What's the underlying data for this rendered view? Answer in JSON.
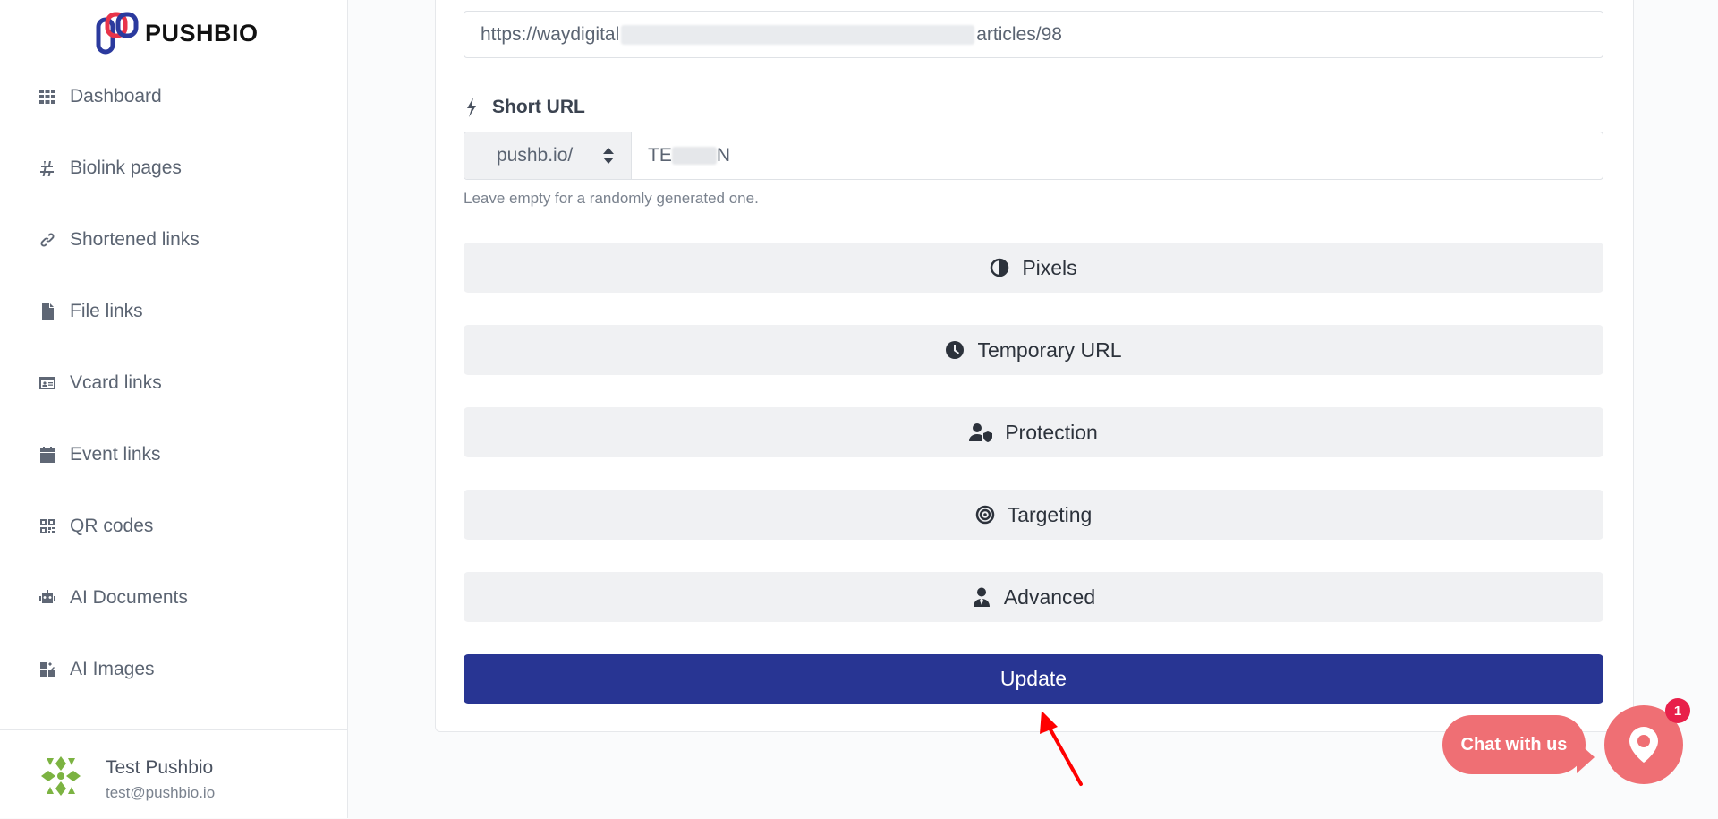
{
  "app": {
    "brand": "PUSHBIO"
  },
  "sidebar": {
    "items": [
      {
        "label": "Dashboard",
        "icon": "grid-icon"
      },
      {
        "label": "Biolink pages",
        "icon": "hash-icon"
      },
      {
        "label": "Shortened links",
        "icon": "link-icon"
      },
      {
        "label": "File links",
        "icon": "file-icon"
      },
      {
        "label": "Vcard links",
        "icon": "id-card-icon"
      },
      {
        "label": "Event links",
        "icon": "calendar-icon"
      },
      {
        "label": "QR codes",
        "icon": "qrcode-icon"
      },
      {
        "label": "AI Documents",
        "icon": "robot-icon"
      },
      {
        "label": "AI Images",
        "icon": "images-icon"
      }
    ],
    "user": {
      "name": "Test Pushbio",
      "email": "test@pushbio.io"
    }
  },
  "form": {
    "destination_url_start": "https://waydigital",
    "destination_url_end": "articles/98",
    "short_url_label": "Short URL",
    "domain_value": "pushb.io/",
    "alias_start": "TE",
    "alias_end": "N",
    "help_text": "Leave empty for a randomly generated one.",
    "sections": [
      {
        "label": "Pixels",
        "icon": "adjust-icon"
      },
      {
        "label": "Temporary URL",
        "icon": "clock-icon"
      },
      {
        "label": "Protection",
        "icon": "user-shield-icon"
      },
      {
        "label": "Targeting",
        "icon": "bullseye-icon"
      },
      {
        "label": "Advanced",
        "icon": "user-tie-icon"
      }
    ],
    "submit_label": "Update"
  },
  "chat": {
    "label": "Chat with us",
    "badge_count": "1"
  },
  "colors": {
    "primary": "#283593",
    "chat": "#ef6f74",
    "badge": "#e8204a"
  }
}
